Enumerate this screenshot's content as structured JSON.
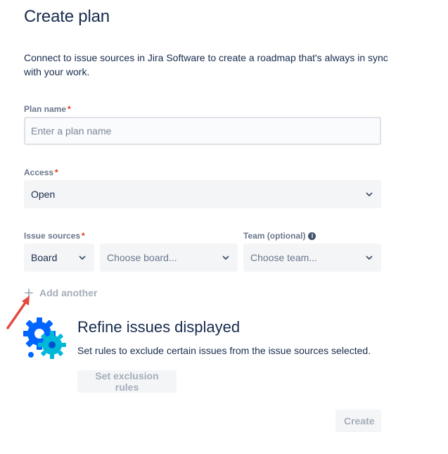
{
  "header": {
    "title": "Create plan",
    "intro": "Connect to issue sources in Jira Software to create a roadmap that's always in sync with your work."
  },
  "plan_name": {
    "label": "Plan name",
    "required_mark": "*",
    "placeholder": "Enter a plan name",
    "value": ""
  },
  "access": {
    "label": "Access",
    "required_mark": "*",
    "value": "Open"
  },
  "issue_sources": {
    "label": "Issue sources",
    "required_mark": "*",
    "type_value": "Board",
    "board_placeholder": "Choose board..."
  },
  "team": {
    "label": "Team (optional)",
    "info_glyph": "i",
    "placeholder": "Choose team..."
  },
  "add_another": {
    "label": "Add another",
    "icon": "plus-icon"
  },
  "refine": {
    "title": "Refine issues displayed",
    "description": "Set rules to exclude certain issues from the issue sources selected.",
    "button_label": "Set exclusion rules",
    "icon": "gear-icon"
  },
  "footer": {
    "create_label": "Create"
  },
  "colors": {
    "text": "#172b4d",
    "label": "#6b778c",
    "required": "#de350b",
    "field_bg": "#f4f5f7",
    "disabled_text": "#a5adba",
    "annotation_arrow": "#e5483f",
    "gear_blue": "#0065ff",
    "gear_cyan": "#00b8d9"
  }
}
